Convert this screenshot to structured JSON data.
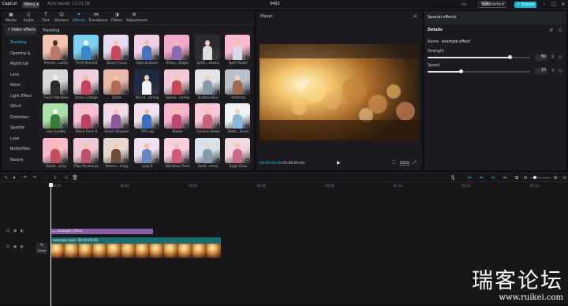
{
  "app": {
    "name": "CapCut",
    "project_title": "0402",
    "auto_save_text": "Auto saved: 11:21:26"
  },
  "titlebar": {
    "menu_label": "Menu",
    "shortcut_label": "Shortcut",
    "export_label": "Export"
  },
  "toolbar": {
    "tabs": [
      {
        "label": "Media",
        "icon": "media-icon"
      },
      {
        "label": "Audio",
        "icon": "audio-icon"
      },
      {
        "label": "Text",
        "icon": "text-icon"
      },
      {
        "label": "Stickers",
        "icon": "stickers-icon"
      },
      {
        "label": "Effects",
        "icon": "effects-icon",
        "active": true
      },
      {
        "label": "Transitions",
        "icon": "transitions-icon"
      },
      {
        "label": "Filters",
        "icon": "filters-icon"
      },
      {
        "label": "Adjustment",
        "icon": "adjustment-icon"
      }
    ]
  },
  "sidebar": {
    "header": "• Video effects",
    "items": [
      "Trending",
      "Opening &...",
      "Nightclub",
      "Lens",
      "Retro",
      "Light Effect",
      "Glitch",
      "Distortion",
      "Sparkle",
      "Love",
      "Butterflies",
      "Nature"
    ]
  },
  "grid": {
    "section_title": "Trending",
    "effects": [
      "Petrolc...uality",
      "Thrill Remind",
      "Blurry Focus",
      "Optical Zoom",
      "Sharp...Edges",
      "Splitt...amera",
      "Split Flicker",
      "Flash Vibration",
      "Xmas Collage",
      "Zoom",
      "Blu-ra...aming",
      "Speed...uming",
      "Surface Blur",
      "Antenna",
      "Low Quality",
      "Black Flash II",
      "Smart Sharpen",
      "TPS Lag",
      "Shake",
      "Camera Shake",
      "Diam...Zoom",
      "Rainb...ising",
      "Play Pendulum",
      "Retoss...ining",
      "Leak II",
      "Vibration Flash",
      "Pand...orme",
      "Edge Glow"
    ]
  },
  "player": {
    "title": "Player",
    "current_time": "00:00:00:00",
    "total_time": "00:00:05:00",
    "ratio_label": "Ratio"
  },
  "details": {
    "panel_title": "Special effects",
    "section_title": "Details",
    "name_label": "Name",
    "name_value": "example effect",
    "strength_label": "Strength",
    "strength_value": "80",
    "strength_fraction": 0.8,
    "speed_label": "Speed",
    "speed_value": "33",
    "speed_fraction": 0.33
  },
  "timeline": {
    "ticks": [
      "00:00",
      "00:02",
      "00:04",
      "00:06",
      "00:08",
      "00:10",
      "00:12",
      "00:14"
    ],
    "effect_clip_label": "example effect",
    "video_clip_name": "example.mp4",
    "video_clip_duration": "00:00:05:00",
    "cover_label": "Cover"
  },
  "watermark": {
    "text": "瑞客论坛",
    "url": "www.ruikei.com"
  },
  "colors": {
    "accent": "#27c2df",
    "effect_clip": "#8a5fa8",
    "video_clip": "#1b6d6d"
  }
}
